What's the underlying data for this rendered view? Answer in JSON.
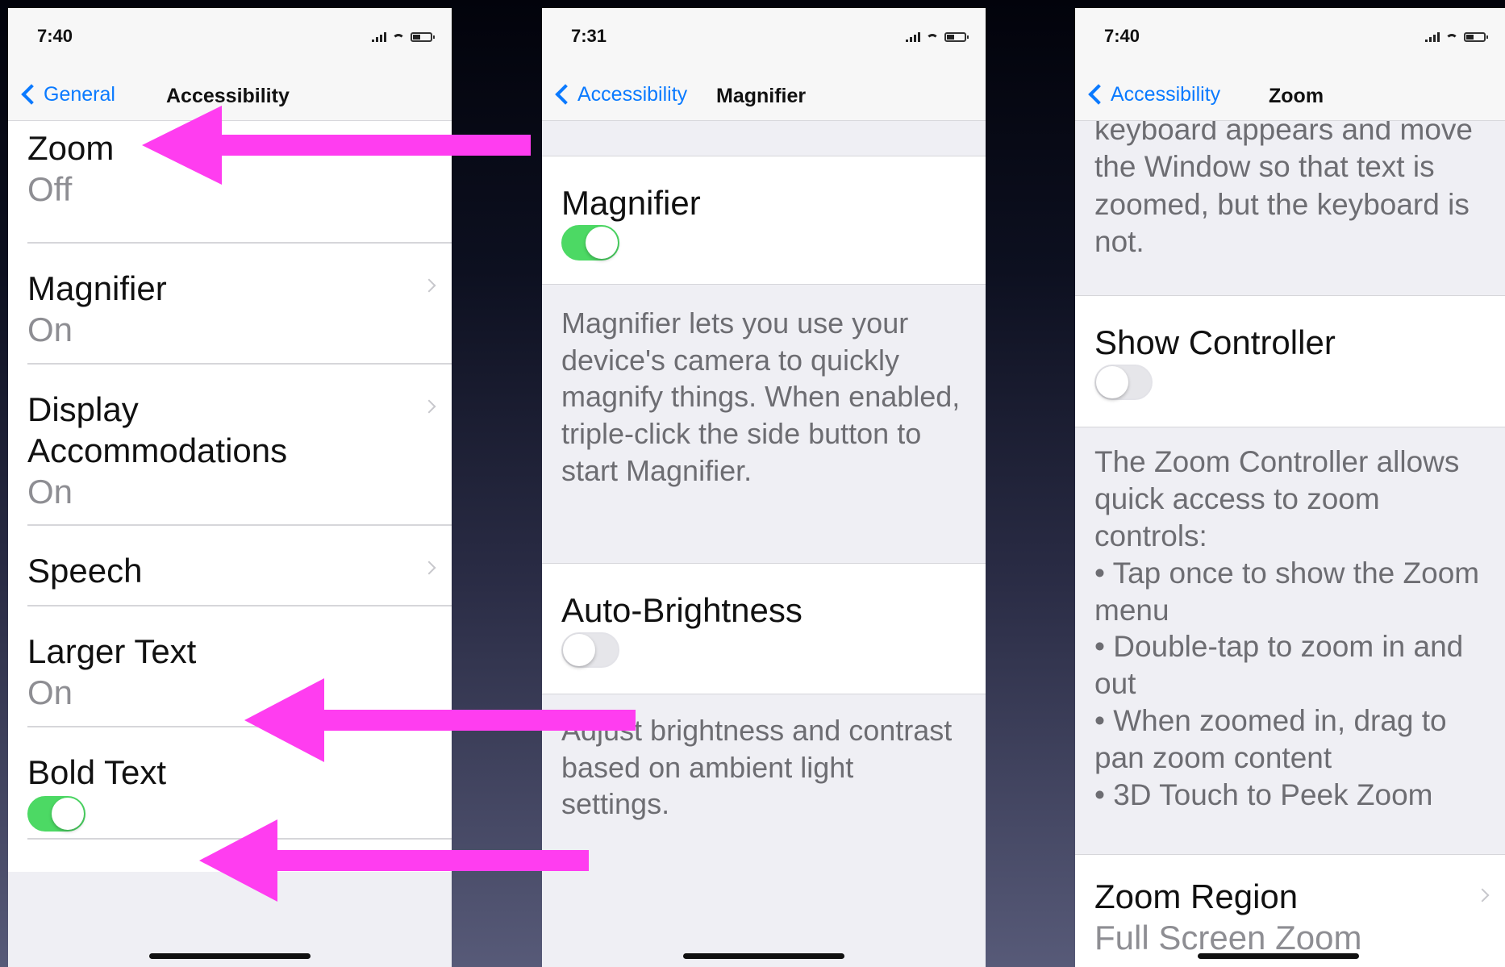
{
  "colors": {
    "ios_blue": "#0a7aff",
    "toggle_on": "#4cd964",
    "arrow": "#ff3df0"
  },
  "screens": [
    {
      "time": "7:40",
      "back_label": "General",
      "title": "Accessibility",
      "rows": [
        {
          "title": "Zoom",
          "value": "Off"
        },
        {
          "title": "Magnifier",
          "value": "On"
        },
        {
          "title": "Display Accommodations",
          "value": "On"
        },
        {
          "title": "Speech"
        },
        {
          "title": "Larger Text",
          "value": "On"
        },
        {
          "title": "Bold Text",
          "toggle": true
        }
      ]
    },
    {
      "time": "7:31",
      "back_label": "Accessibility",
      "title": "Magnifier",
      "magnifier": {
        "label": "Magnifier",
        "on": true,
        "footer": "Magnifier lets you use your device's camera to quickly magnify things. When enabled, triple-click the side button to start Magnifier."
      },
      "auto_brightness": {
        "label": "Auto-Brightness",
        "on": false,
        "footer": "Adjust brightness and contrast based on ambient light settings."
      }
    },
    {
      "time": "7:40",
      "back_label": "Accessibility",
      "title": "Zoom",
      "top_footer": "keyboard appears and move the Window so that text is zoomed, but the keyboard is not.",
      "show_controller": {
        "label": "Show Controller",
        "on": false
      },
      "controller_footer": [
        "The Zoom Controller allows quick access to zoom controls:",
        "• Tap once to show the Zoom menu",
        "• Double-tap to zoom in and out",
        "• When zoomed in, drag to pan zoom content",
        "• 3D Touch to Peek Zoom"
      ],
      "zoom_region": {
        "title": "Zoom Region",
        "value": "Full Screen Zoom"
      }
    }
  ]
}
